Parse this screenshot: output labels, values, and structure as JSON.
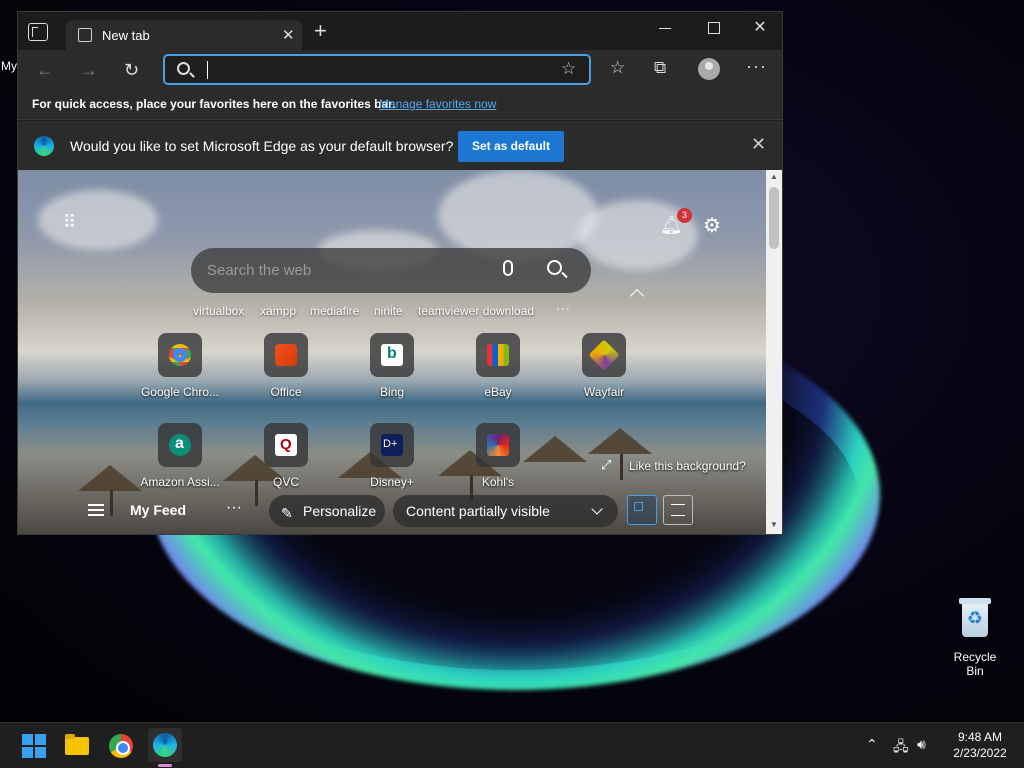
{
  "desktop": {
    "partial_label": "My",
    "recycle_bin_label": "Recycle Bin"
  },
  "window": {
    "tab_title": "New tab"
  },
  "address_bar": {
    "value": ""
  },
  "favorites_bar": {
    "message": "For quick access, place your favorites here on the favorites bar.",
    "link": "Manage favorites now"
  },
  "infobar": {
    "question": "Would you like to set Microsoft Edge as your default browser?",
    "button": "Set as default"
  },
  "newtab": {
    "notification_count": "3",
    "search_placeholder": "Search the web",
    "quick_links": [
      "virtualbox",
      "xampp",
      "mediafire",
      "ninite",
      "teamviewer download"
    ],
    "tiles_row1": [
      "Google Chro...",
      "Office",
      "Bing",
      "eBay",
      "Wayfair"
    ],
    "tiles_row2": [
      "Amazon Assi...",
      "QVC",
      "Disney+",
      "Kohl's"
    ],
    "like_background": "Like this background?",
    "feed": {
      "title": "My Feed",
      "personalize": "Personalize",
      "content_visibility": "Content partially visible"
    }
  },
  "taskbar": {
    "time": "9:48 AM",
    "date": "2/23/2022"
  },
  "colors": {
    "accent": "#1b77d2",
    "link": "#59a8f0",
    "badge": "#d13438"
  }
}
